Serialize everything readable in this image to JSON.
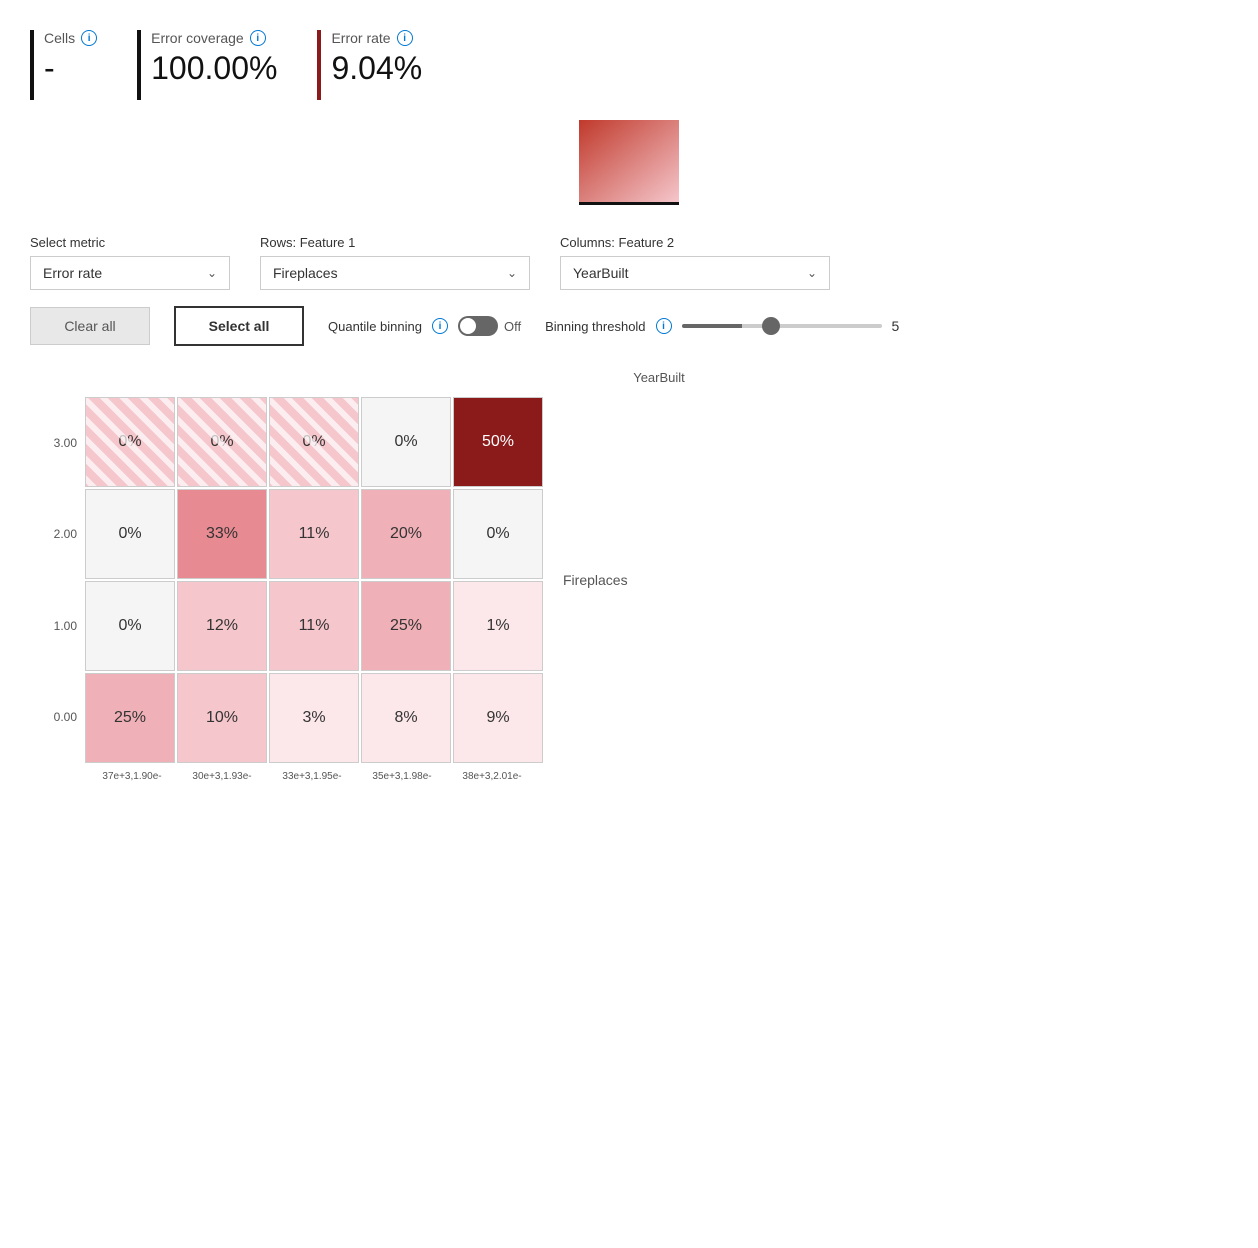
{
  "metrics": {
    "cells": {
      "label": "Cells",
      "value": "-"
    },
    "error_coverage": {
      "label": "Error coverage",
      "value": "100.00%"
    },
    "error_rate": {
      "label": "Error rate",
      "value": "9.04%"
    }
  },
  "controls": {
    "select_metric_label": "Select metric",
    "select_metric_value": "Error rate",
    "rows_label": "Rows: Feature 1",
    "rows_value": "Fireplaces",
    "columns_label": "Columns: Feature 2",
    "columns_value": "YearBuilt",
    "clear_all_label": "Clear all",
    "select_all_label": "Select all",
    "quantile_label": "Quantile binning",
    "quantile_off": "Off",
    "binning_label": "Binning threshold",
    "binning_value": "5"
  },
  "matrix": {
    "col_header": "YearBuilt",
    "row_header": "Fireplaces",
    "y_labels": [
      "3.00",
      "2.00",
      "1.00",
      "0.00"
    ],
    "x_labels": [
      "37e+3,1.90e-",
      "30e+3,1.93e-",
      "33e+3,1.95e-",
      "35e+3,1.98e-",
      "38e+3,2.01e-"
    ],
    "cells": [
      {
        "value": "0%",
        "style": "hatched",
        "row": 0,
        "col": 0
      },
      {
        "value": "0%",
        "style": "hatched",
        "row": 0,
        "col": 1
      },
      {
        "value": "0%",
        "style": "hatched",
        "row": 0,
        "col": 2
      },
      {
        "value": "0%",
        "style": "plain",
        "row": 0,
        "col": 3
      },
      {
        "value": "50%",
        "style": "dark-red",
        "row": 0,
        "col": 4
      },
      {
        "value": "0%",
        "style": "plain",
        "row": 1,
        "col": 0
      },
      {
        "value": "33%",
        "style": "mid-pink",
        "row": 1,
        "col": 1
      },
      {
        "value": "11%",
        "style": "light-pink",
        "row": 1,
        "col": 2
      },
      {
        "value": "20%",
        "style": "pink2",
        "row": 1,
        "col": 3
      },
      {
        "value": "0%",
        "style": "plain",
        "row": 1,
        "col": 4
      },
      {
        "value": "0%",
        "style": "plain",
        "row": 2,
        "col": 0
      },
      {
        "value": "12%",
        "style": "light-pink",
        "row": 2,
        "col": 1
      },
      {
        "value": "11%",
        "style": "light-pink",
        "row": 2,
        "col": 2
      },
      {
        "value": "25%",
        "style": "pink2",
        "row": 2,
        "col": 3
      },
      {
        "value": "1%",
        "style": "very-light-pink",
        "row": 2,
        "col": 4
      },
      {
        "value": "25%",
        "style": "pink2",
        "row": 3,
        "col": 0
      },
      {
        "value": "10%",
        "style": "light-pink",
        "row": 3,
        "col": 1
      },
      {
        "value": "3%",
        "style": "very-light-pink",
        "row": 3,
        "col": 2
      },
      {
        "value": "8%",
        "style": "very-light-pink",
        "row": 3,
        "col": 3
      },
      {
        "value": "9%",
        "style": "very-light-pink",
        "row": 3,
        "col": 4
      }
    ]
  }
}
